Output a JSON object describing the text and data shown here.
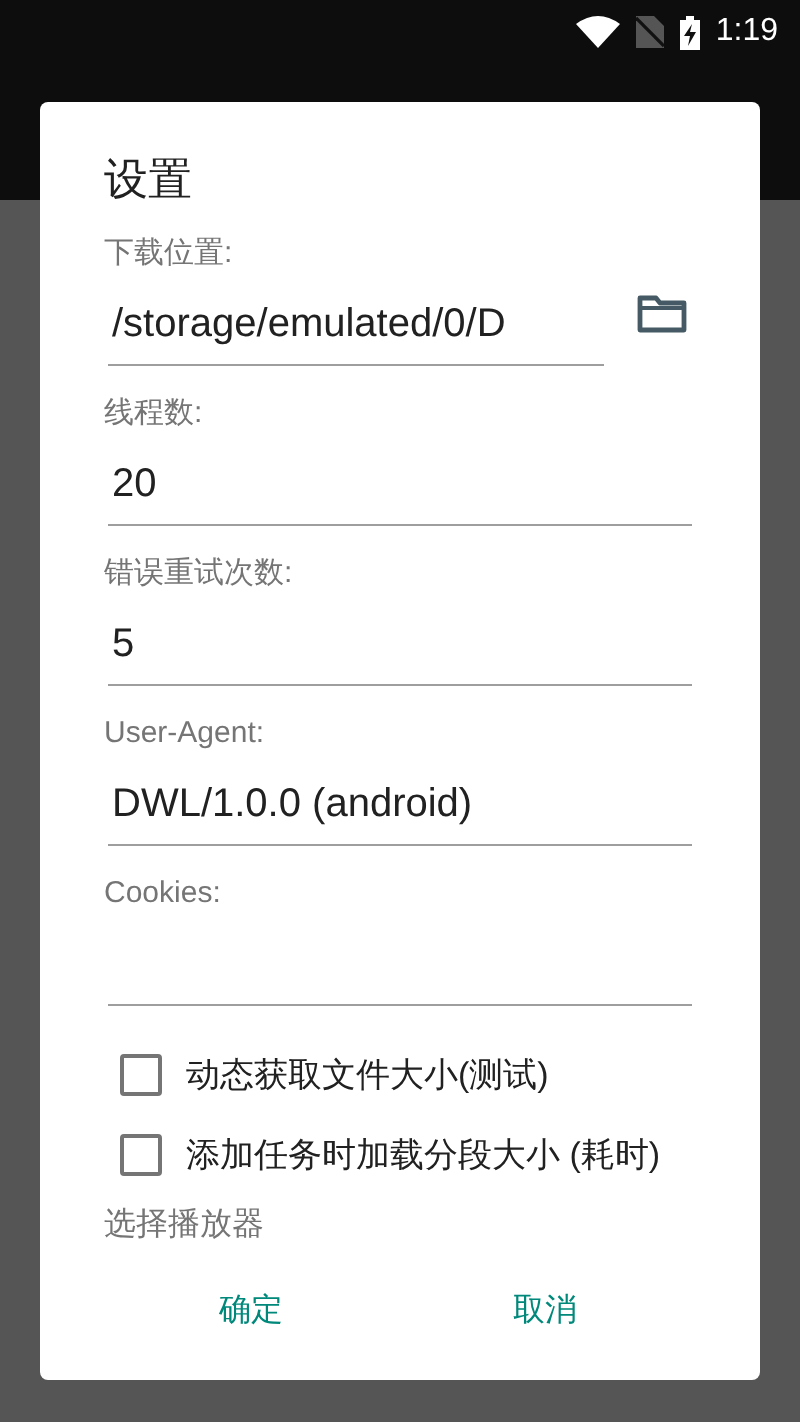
{
  "status_bar": {
    "time": "1:19"
  },
  "dialog": {
    "title": "设置",
    "fields": [
      {
        "label": "下载位置:",
        "value": "/storage/emulated/0/D",
        "kind": "folder"
      },
      {
        "label": "线程数:",
        "value": "20",
        "kind": "text"
      },
      {
        "label": "错误重试次数:",
        "value": "5",
        "kind": "text"
      },
      {
        "label": "User-Agent:",
        "value": "DWL/1.0.0 (android)",
        "kind": "text"
      },
      {
        "label": "Cookies:",
        "kind": "text"
      }
    ],
    "checkboxes": [
      {
        "label": "动态获取文件大小(测试)",
        "checked": false
      },
      {
        "label": "添加任务时加载分段大小 (耗时)",
        "checked": false
      }
    ],
    "player_label": "选择播放器",
    "buttons": [
      "确定",
      "取消"
    ]
  }
}
